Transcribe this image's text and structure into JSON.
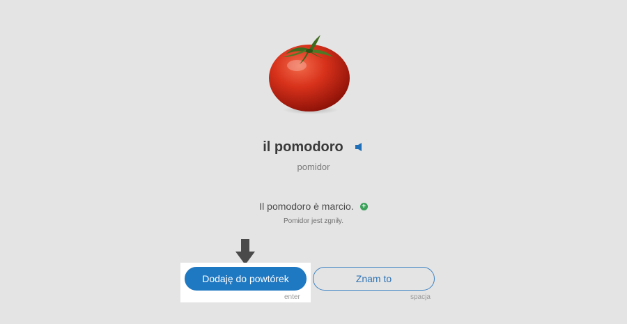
{
  "card": {
    "word": "il pomodoro",
    "translation": "pomidor",
    "image_icon": "tomato-image",
    "speaker_icon": "speaker-icon"
  },
  "example": {
    "sentence": "Il pomodoro è marcio.",
    "translation": "Pomidor jest zgniły.",
    "add_icon": "plus-icon"
  },
  "actions": {
    "add_label": "Dodaję do powtórek",
    "add_hint": "enter",
    "know_label": "Znam to",
    "know_hint": "spacja"
  },
  "colors": {
    "background": "#e4e4e4",
    "primary": "#1e78c2",
    "plus": "#3aa05a"
  }
}
